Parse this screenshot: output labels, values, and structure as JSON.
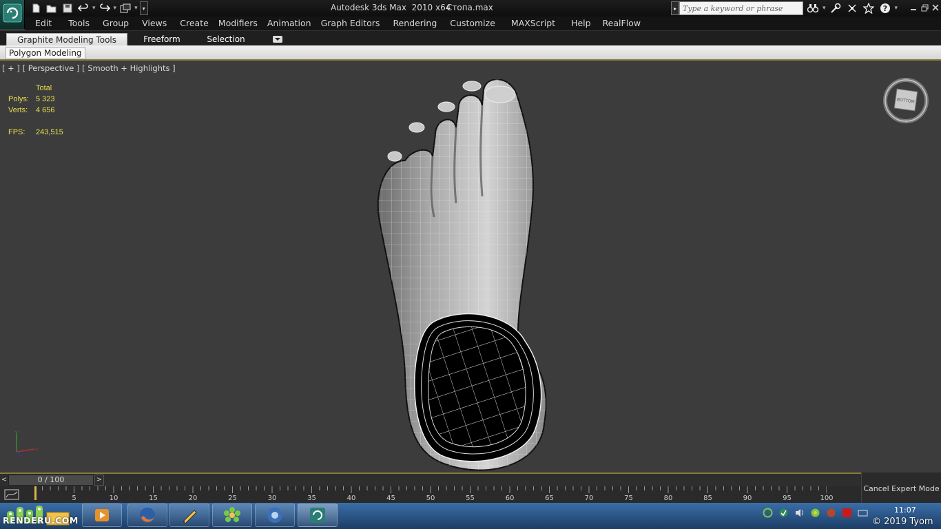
{
  "title_bar": {
    "app_title": "Autodesk 3ds Max  2010 x64",
    "file_name": "Стопа.max",
    "search_placeholder": "Type a keyword or phrase"
  },
  "quick_access": [
    "new-icon",
    "open-icon",
    "save-icon",
    "undo-icon",
    "redo-icon",
    "project-folder-icon"
  ],
  "menu": [
    "Edit",
    "Tools",
    "Group",
    "Views",
    "Create",
    "Modifiers",
    "Animation",
    "Graph Editors",
    "Rendering",
    "Customize",
    "MAXScript",
    "Help",
    "RealFlow"
  ],
  "ribbon": {
    "tabs": [
      "Graphite Modeling Tools",
      "Freeform",
      "Selection"
    ],
    "active_tab": "Graphite Modeling Tools",
    "panel_label": "Polygon Modeling"
  },
  "viewport": {
    "label": "[ + ] [ Perspective ] [ Smooth + Highlights ]",
    "stats": {
      "header": "Total",
      "polys_label": "Polys:",
      "polys_value": "5 323",
      "verts_label": "Verts:",
      "verts_value": "4 656",
      "fps_label": "FPS:",
      "fps_value": "243,515"
    },
    "viewcube_face": "BOTTOM",
    "model": "foot-mesh"
  },
  "timeline": {
    "frame_display": "0 / 100",
    "prev_label": "<",
    "next_label": ">",
    "ticks": [
      "5",
      "10",
      "15",
      "20",
      "25",
      "30",
      "35",
      "40",
      "45",
      "50",
      "55",
      "60",
      "65",
      "70",
      "75",
      "80",
      "85",
      "90",
      "95",
      "100"
    ],
    "cancel_expert": "Cancel Expert Mode"
  },
  "taskbar": {
    "clock": "11:07",
    "apps": [
      "media-player-icon",
      "firefox-icon",
      "paint-icon",
      "icq-icon",
      "chrome-icon",
      "3dsmax-icon"
    ]
  },
  "watermarks": {
    "left": "RENDERU.COM",
    "right": "© 2019 Tyom"
  },
  "colors": {
    "stats_text": "#e8e04e",
    "viewport_bg": "#3c3c3c",
    "accent_line": "#8a7a3a"
  }
}
